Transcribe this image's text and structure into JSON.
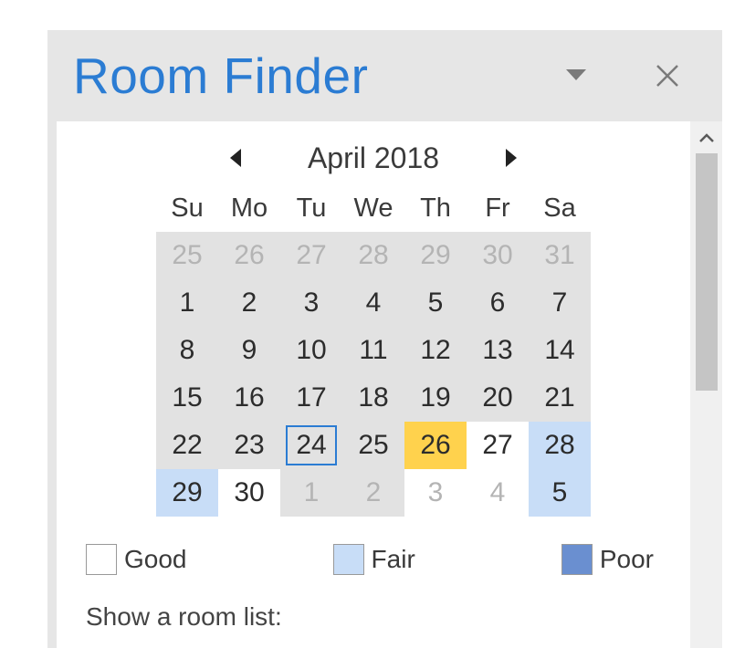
{
  "header": {
    "title": "Room Finder"
  },
  "calendar": {
    "month_label": "April 2018",
    "day_headers": [
      "Su",
      "Mo",
      "Tu",
      "We",
      "Th",
      "Fr",
      "Sa"
    ],
    "cells": [
      {
        "d": "25",
        "cls": "out"
      },
      {
        "d": "26",
        "cls": "out"
      },
      {
        "d": "27",
        "cls": "out"
      },
      {
        "d": "28",
        "cls": "out"
      },
      {
        "d": "29",
        "cls": "out"
      },
      {
        "d": "30",
        "cls": "out"
      },
      {
        "d": "31",
        "cls": "out"
      },
      {
        "d": "1",
        "cls": ""
      },
      {
        "d": "2",
        "cls": ""
      },
      {
        "d": "3",
        "cls": ""
      },
      {
        "d": "4",
        "cls": ""
      },
      {
        "d": "5",
        "cls": ""
      },
      {
        "d": "6",
        "cls": ""
      },
      {
        "d": "7",
        "cls": ""
      },
      {
        "d": "8",
        "cls": ""
      },
      {
        "d": "9",
        "cls": ""
      },
      {
        "d": "10",
        "cls": ""
      },
      {
        "d": "11",
        "cls": ""
      },
      {
        "d": "12",
        "cls": ""
      },
      {
        "d": "13",
        "cls": ""
      },
      {
        "d": "14",
        "cls": ""
      },
      {
        "d": "15",
        "cls": ""
      },
      {
        "d": "16",
        "cls": ""
      },
      {
        "d": "17",
        "cls": ""
      },
      {
        "d": "18",
        "cls": ""
      },
      {
        "d": "19",
        "cls": ""
      },
      {
        "d": "20",
        "cls": ""
      },
      {
        "d": "21",
        "cls": ""
      },
      {
        "d": "22",
        "cls": ""
      },
      {
        "d": "23",
        "cls": ""
      },
      {
        "d": "24",
        "cls": "today"
      },
      {
        "d": "25",
        "cls": ""
      },
      {
        "d": "26",
        "cls": "highlight"
      },
      {
        "d": "27",
        "cls": "whitecur"
      },
      {
        "d": "28",
        "cls": "fair"
      },
      {
        "d": "29",
        "cls": "fair"
      },
      {
        "d": "30",
        "cls": "whitecur"
      },
      {
        "d": "1",
        "cls": "out"
      },
      {
        "d": "2",
        "cls": "out"
      },
      {
        "d": "3",
        "cls": "whitebg"
      },
      {
        "d": "4",
        "cls": "whitebg"
      },
      {
        "d": "5",
        "cls": "fair out"
      }
    ]
  },
  "legend": {
    "good": "Good",
    "fair": "Fair",
    "poor": "Poor"
  },
  "room_list_prompt": "Show a room list:",
  "colors": {
    "accent": "#2b7cd3",
    "fair": "#c8ddf7",
    "poor": "#6a8fd0",
    "highlight": "#ffd24d"
  }
}
